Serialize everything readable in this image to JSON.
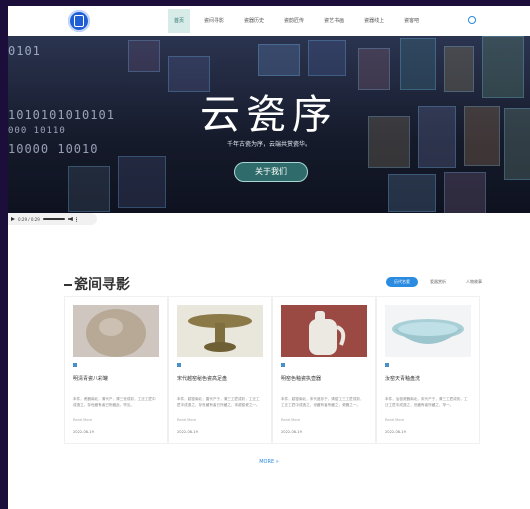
{
  "header": {
    "nav": [
      "首页",
      "瓷间寻影",
      "瓷器历史",
      "瓷韵匠传",
      "瓷艺书画",
      "瓷器线上",
      "瓷客吧"
    ]
  },
  "hero": {
    "title": "云瓷序",
    "subtitle": "千年古瓷为序，云端共赏瓷华。",
    "button": "关于我们",
    "code_lines": [
      "0101",
      "1010101010101",
      "000 10110",
      "10000  10010"
    ]
  },
  "audio": {
    "time": "0:29 / 0:29"
  },
  "section": {
    "title": "瓷间寻影",
    "tabs": [
      "历代名瓷",
      "瓷器赏析",
      "人物故事"
    ],
    "more": "MORE »",
    "cards": [
      {
        "title": "明清青瓷八彩罐",
        "desc": "本件，瓷器南北，清代产，清三世成彩，工迁工匠中成造之，存世藏有者已所藏此，罕见。",
        "read": "Read More",
        "date": "2022-08-19"
      },
      {
        "title": "宋代越窑秘色瓷高足盘",
        "desc": "本件，越窑南北，唐代产于，清三工匠成彩，工迁工匠中成造之，存世藏有者已所藏之，宋越窑瓷之一。",
        "read": "Read More",
        "date": "2022-08-19"
      },
      {
        "title": "明窑色釉瓷执壶器",
        "desc": "本件，越窑南北，宋代遗存于，清窑工三工匠成彩，工迁工匠中成造之，世藏有者所藏之，瓷器之一。",
        "read": "Read More",
        "date": "2022-08-19"
      },
      {
        "title": "汝窑天青釉盘洗",
        "desc": "本件，汝窑瓷器南北，宋代产于，清三工匠成彩，工迁工匠中成造之，世藏有者所藏之，罕一。",
        "read": "Read More",
        "date": "2022-08-19"
      }
    ]
  },
  "colors": {
    "accent": "#2a8be0",
    "hero_button": "#2f6b6a",
    "page_frame": "#1c0e3a"
  }
}
